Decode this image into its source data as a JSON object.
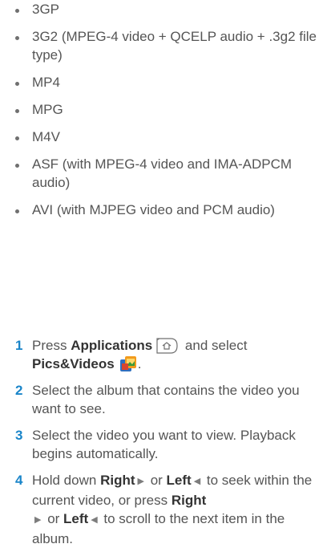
{
  "formats": [
    "3GP",
    "3G2 (MPEG-4 video + QCELP audio + .3g2 file type)",
    "MP4",
    "MPG",
    "M4V",
    "ASF (with MPEG-4 video and IMA-ADPCM audio)",
    "AVI (with MJPEG video and PCM audio)"
  ],
  "steps": [
    {
      "number": "1",
      "t1": "Press ",
      "b1": "Applications",
      "t2": " and select ",
      "b2": "Pics&Videos",
      "t3": "."
    },
    {
      "number": "2",
      "text": "Select the album that contains the video you want to see."
    },
    {
      "number": "3",
      "text": "Select the video you want to view. Playback begins automatically."
    },
    {
      "number": "4",
      "t1": "Hold down ",
      "b1": "Right",
      "t2": " or ",
      "b2": "Left",
      "t3": " to seek within the current video, or press ",
      "b3": "Right",
      "t4": " or ",
      "b4": "Left",
      "t5": " to scroll to the next item in the album.",
      "right_glyph": "▶",
      "left_glyph": "◀"
    }
  ],
  "icons": {
    "applications_key": "applications-key-icon",
    "pics_videos": "pics-videos-icon",
    "right_arrow": "right-arrow-icon",
    "left_arrow": "left-arrow-icon"
  },
  "colors": {
    "step_number": "#1a85c9",
    "body_text": "#555555",
    "bold_text": "#333333"
  }
}
